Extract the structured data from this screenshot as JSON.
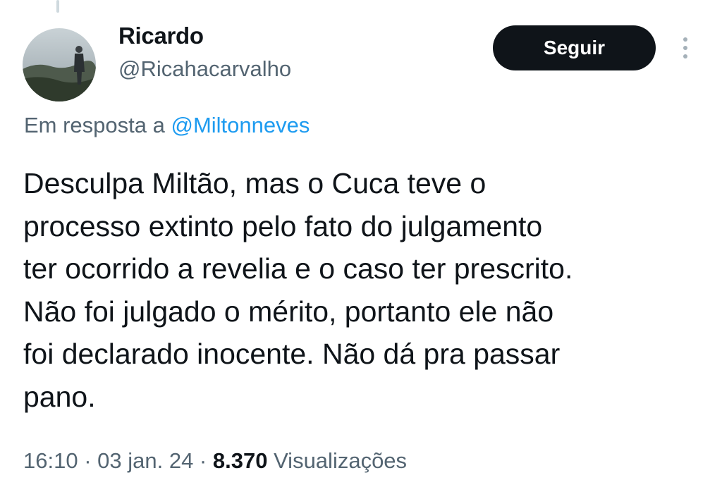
{
  "user": {
    "display_name": "Ricardo",
    "handle": "@Ricahacarvalho"
  },
  "actions": {
    "follow_label": "Seguir",
    "more_icon": "more-vertical-icon"
  },
  "reply": {
    "prefix": "Em resposta a ",
    "mention": "@Miltonneves"
  },
  "tweet": {
    "text": "Desculpa Miltão, mas o Cuca teve o\nprocesso extinto pelo fato do julgamento\nter ocorrido a revelia e o caso ter prescrito.\nNão foi julgado o mérito, portanto ele não\nfoi declarado inocente. Não dá pra passar\npano."
  },
  "meta": {
    "time": "16:10",
    "separator": " · ",
    "date": "03 jan. 24",
    "views_count": "8.370",
    "views_label": " Visualizações"
  },
  "colors": {
    "text_primary": "#0f1419",
    "text_secondary": "#536471",
    "link": "#1d9bf0",
    "button_bg": "#0f1419"
  }
}
